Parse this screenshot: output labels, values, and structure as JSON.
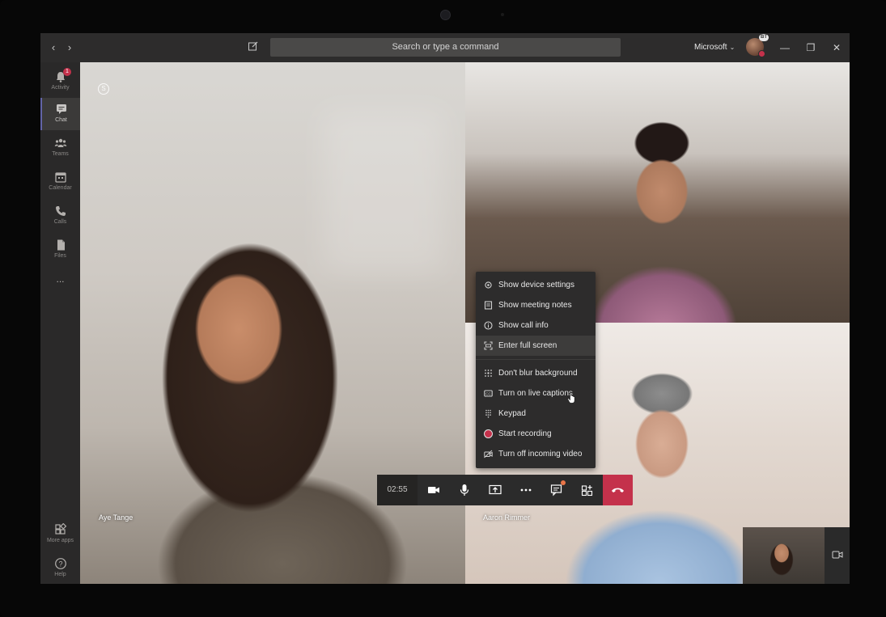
{
  "titlebar": {
    "search_placeholder": "Search or type a command",
    "tenant": "Microsoft",
    "avatar_badge": "BT"
  },
  "rail": {
    "items": [
      {
        "label": "Activity",
        "badge": "1"
      },
      {
        "label": "Chat"
      },
      {
        "label": "Teams"
      },
      {
        "label": "Calendar"
      },
      {
        "label": "Calls"
      },
      {
        "label": "Files"
      },
      {
        "label": "..."
      }
    ],
    "bottom": [
      {
        "label": "More apps"
      },
      {
        "label": "Help"
      }
    ]
  },
  "participants": {
    "left_name": "Aye Tange",
    "right_name": "Aaron Rimmer"
  },
  "controls": {
    "timer": "02:55"
  },
  "menu": {
    "items": [
      "Show device settings",
      "Show meeting notes",
      "Show call info",
      "Enter full screen",
      "Don't blur background",
      "Turn on live captions",
      "Keypad",
      "Start recording",
      "Turn off incoming video"
    ]
  },
  "colors": {
    "hangup": "#c4314b",
    "accent": "#6264a7",
    "notification": "#e97548"
  }
}
